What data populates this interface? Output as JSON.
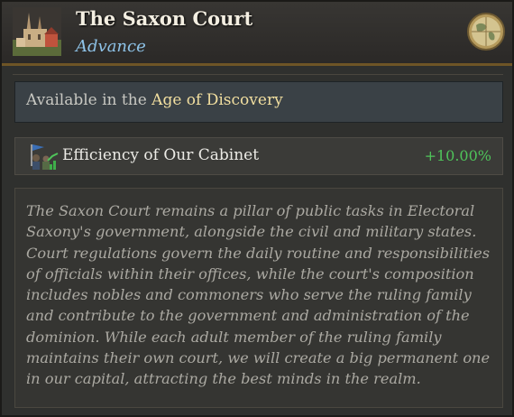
{
  "header": {
    "title": "The Saxon Court",
    "subtitle": "Advance",
    "icon": "cathedral-town-icon",
    "right_icon": "globe-icon"
  },
  "availability": {
    "prefix": "Available in the",
    "age": "Age of Discovery"
  },
  "modifiers": [
    {
      "icon": "cabinet-efficiency-icon",
      "label": "Efficiency of Our Cabinet",
      "value": "+10.00%"
    }
  ],
  "description": "The Saxon Court remains a pillar of public tasks in Electoral Saxony's government, alongside the civil and military states. Court regulations govern the daily routine and responsibilities of officials within their offices, while the court's composition includes nobles and commoners who serve the ruling family and contribute to the government and administration of the dominion. While each adult member of the ruling family maintains their own court, we will create a big permanent one in our capital, attracting the best minds in the realm.",
  "colors": {
    "title": "#f4efe2",
    "subtitle": "#8ec3e8",
    "age_highlight": "#f2dfa0",
    "positive_value": "#4fc45a",
    "header_border": "#6e5526"
  }
}
